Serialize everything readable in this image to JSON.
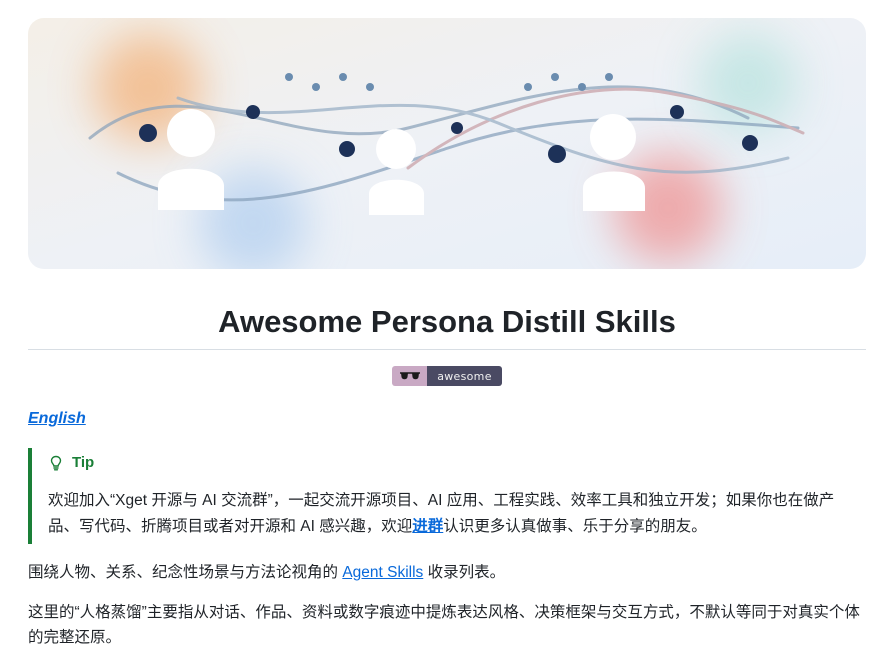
{
  "title": "Awesome Persona Distill Skills",
  "badge": {
    "icon": "sunglasses-icon",
    "label": "awesome"
  },
  "language_link": "English",
  "tip": {
    "label": "Tip",
    "icon": "lightbulb-icon",
    "text_before": "欢迎加入“Xget 开源与 AI 交流群”，一起交流开源项目、AI 应用、工程实践、效率工具和独立开发；如果你也在做产品、写代码、折腾项目或者对开源和 AI 感兴趣，欢迎",
    "link": "进群",
    "text_after": "认识更多认真做事、乐于分享的朋友。"
  },
  "intro": {
    "before": "围绕人物、关系、纪念性场景与方法论视角的 ",
    "link": "Agent Skills",
    "after": " 收录列表。"
  },
  "note": "这里的“人格蒸馏”主要指从对话、作品、资料或数字痕迹中提炼表达风格、决策框架与交互方式，不默认等同于对真实个体的完整还原。",
  "colors": {
    "link": "#0969da",
    "tip_accent": "#1a7f37",
    "badge_left": "#c9a9c4",
    "badge_right": "#4a4a63",
    "text": "#1f2328"
  }
}
